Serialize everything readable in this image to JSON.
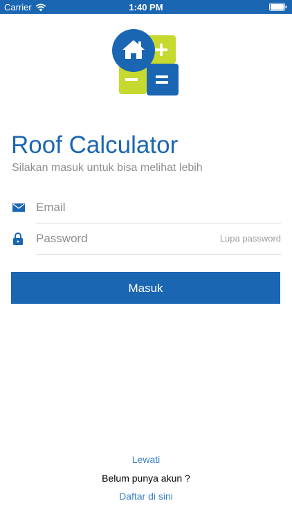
{
  "status_bar": {
    "carrier": "Carrier",
    "time": "1:40 PM",
    "background_color": "#1b66b3",
    "icons": [
      "wifi-icon",
      "battery-icon"
    ]
  },
  "logo": {
    "icon": "roof-calculator-logo",
    "colors": {
      "blue": "#1b66b3",
      "green": "#c6d92e"
    }
  },
  "header": {
    "title": "Roof Calculator",
    "subtitle": "Silakan masuk untuk bisa melihat lebih"
  },
  "form": {
    "email": {
      "icon": "envelope-icon",
      "placeholder": "Email",
      "value": ""
    },
    "password": {
      "icon": "lock-icon",
      "placeholder": "Password",
      "value": ""
    },
    "forgot_password": "Lupa password",
    "login_button": "Masuk"
  },
  "footer": {
    "skip": "Lewati",
    "no_account": "Belum punya akun ?",
    "register": "Daftar di sini"
  },
  "colors": {
    "accent": "#1b66b3",
    "link": "#3b82c4",
    "muted": "#8e8e8e"
  }
}
